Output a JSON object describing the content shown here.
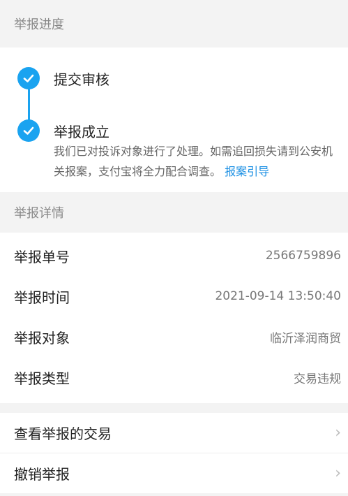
{
  "progress": {
    "header": "举报进度",
    "steps": [
      {
        "title": "提交审核"
      },
      {
        "title": "举报成立",
        "description": "我们已对投诉对象进行了处理。如需追回损失请到公安机关报案，支付宝将全力配合调查。",
        "link": "报案引导"
      }
    ]
  },
  "details": {
    "header": "举报详情",
    "rows": [
      {
        "label": "举报单号",
        "value": "2566759896"
      },
      {
        "label": "举报时间",
        "value": "2021-09-14 13:50:40"
      },
      {
        "label": "举报对象",
        "value": "临沂泽润商贸"
      },
      {
        "label": "举报类型",
        "value": "交易违规"
      }
    ]
  },
  "actions": [
    {
      "label": "查看举报的交易"
    },
    {
      "label": "撤销举报"
    }
  ],
  "colors": {
    "accent": "#1aa3f0",
    "link": "#1a8fe3"
  }
}
